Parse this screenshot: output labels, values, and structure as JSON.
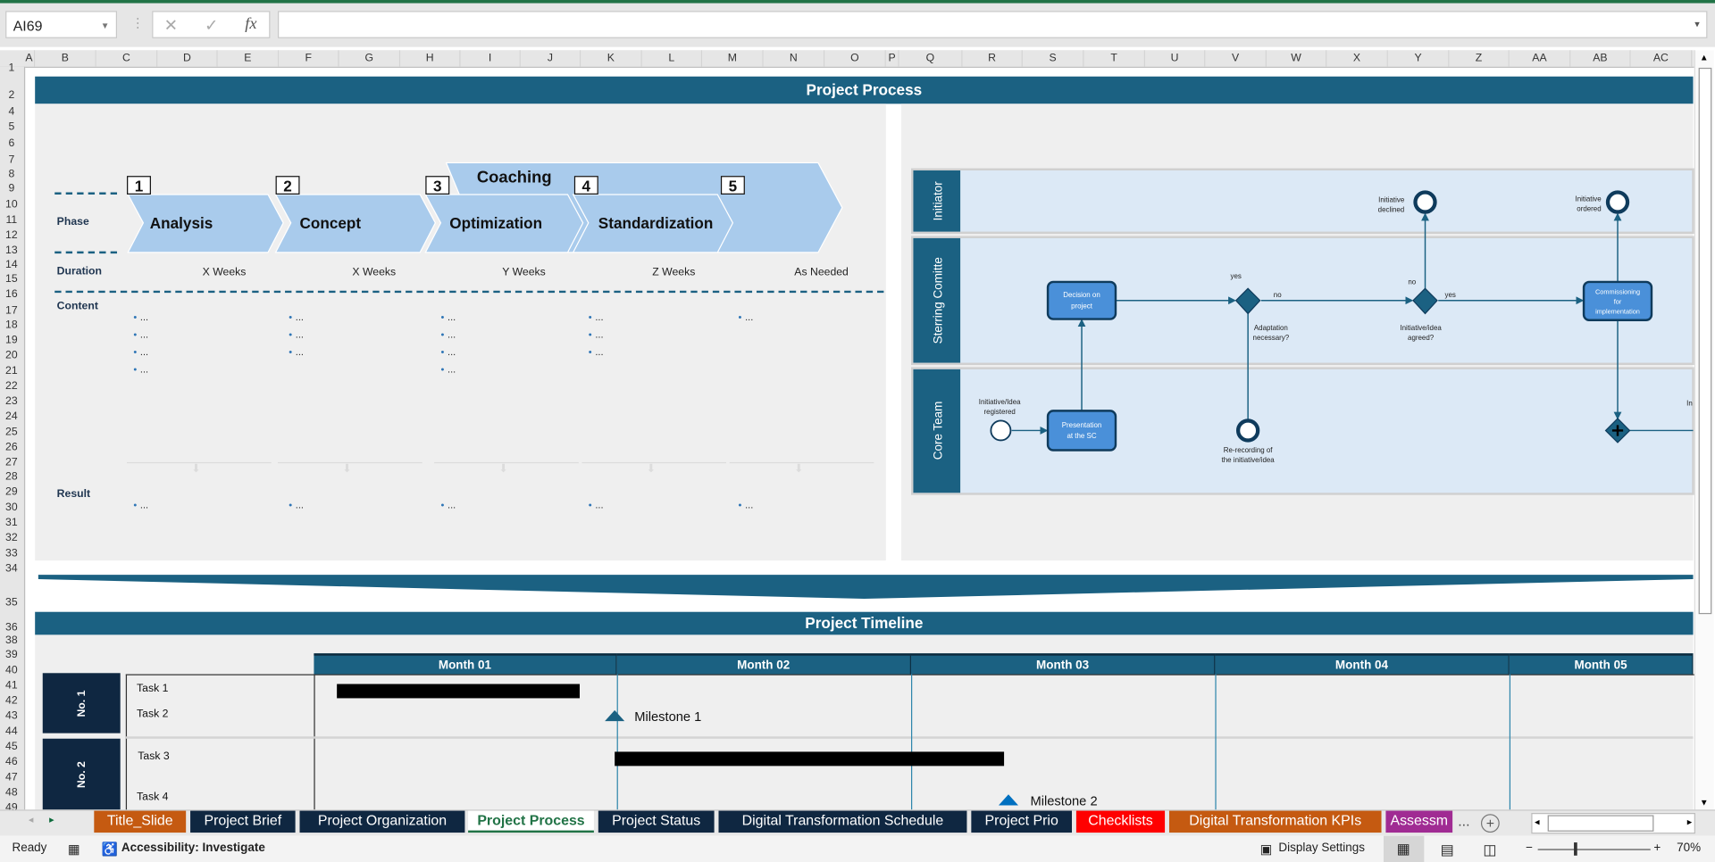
{
  "formula_bar": {
    "name_box": "AI69",
    "cancel_icon": "✕",
    "enter_icon": "✓",
    "fx_label": "fx",
    "formula": ""
  },
  "columns": [
    "A",
    "B",
    "C",
    "D",
    "E",
    "F",
    "G",
    "H",
    "I",
    "J",
    "K",
    "L",
    "M",
    "N",
    "O",
    "P",
    "Q",
    "R",
    "S",
    "T",
    "U",
    "V",
    "W",
    "X",
    "Y",
    "Z",
    "AA",
    "AB",
    "AC"
  ],
  "rows": [
    "1",
    "2",
    "4",
    "5",
    "6",
    "7",
    "8",
    "9",
    "10",
    "11",
    "12",
    "13",
    "14",
    "15",
    "16",
    "17",
    "18",
    "19",
    "20",
    "21",
    "22",
    "23",
    "24",
    "25",
    "26",
    "27",
    "28",
    "29",
    "30",
    "31",
    "32",
    "33",
    "34",
    "35",
    "36",
    "38",
    "39",
    "40",
    "41",
    "42",
    "43",
    "44",
    "45",
    "46",
    "47",
    "48",
    "49"
  ],
  "process": {
    "title": "Project Process",
    "labels": {
      "phase": "Phase",
      "duration": "Duration",
      "content": "Content",
      "result": "Result"
    },
    "coaching": "Coaching",
    "phases": [
      {
        "num": "1",
        "name": "Analysis",
        "duration": "X Weeks",
        "content": [
          "...",
          "...",
          "...",
          "..."
        ],
        "result": [
          "..."
        ]
      },
      {
        "num": "2",
        "name": "Concept",
        "duration": "X Weeks",
        "content": [
          "...",
          "...",
          "..."
        ],
        "result": [
          "..."
        ]
      },
      {
        "num": "3",
        "name": "Optimization",
        "duration": "Y Weeks",
        "content": [
          "...",
          "...",
          "...",
          "..."
        ],
        "result": [
          "..."
        ]
      },
      {
        "num": "4",
        "name": "Standardization",
        "duration": "Z Weeks",
        "content": [
          "...",
          "...",
          "..."
        ],
        "result": [
          "..."
        ]
      },
      {
        "num": "5",
        "name": "",
        "duration": "As Needed",
        "content": [
          "..."
        ],
        "result": [
          "..."
        ]
      }
    ],
    "colors": {
      "chevron": "#a9cbec",
      "band": "#1b6182"
    }
  },
  "swimlane": {
    "lanes": [
      "Initiator",
      "Sterring Comitte",
      "Core Team"
    ],
    "decision_box": [
      "Decision on",
      "project"
    ],
    "presentation_box": [
      "Presentation",
      "at the SC"
    ],
    "commissioning_box": [
      "Commissioning",
      "for",
      "implementation"
    ],
    "start_label": [
      "Initiative/Idea",
      "registered"
    ],
    "declined_label": [
      "Initiative",
      "declined"
    ],
    "ordered_label": [
      "Initiative",
      "ordered"
    ],
    "adaptation_label": [
      "Adaptation",
      "necessary?"
    ],
    "agreed_label": [
      "Initiative/idea",
      "agreed?"
    ],
    "rerecording_label": [
      "Re-recording of",
      "the initiative/idea"
    ],
    "yes": "yes",
    "no": "no",
    "clipped_label": "In"
  },
  "timeline": {
    "title": "Project Timeline",
    "months": [
      "Month 01",
      "Month 02",
      "Month 03",
      "Month 04",
      "Month 05"
    ],
    "groups": [
      {
        "label": "No. 1",
        "tasks": [
          "Task 1",
          "Task 2"
        ]
      },
      {
        "label": "No. 2",
        "tasks": [
          "Task 3",
          "Task 4"
        ]
      }
    ],
    "milestones": [
      "Milestone 1",
      "Milestone 2"
    ]
  },
  "tabs": [
    {
      "label": "Title_Slide",
      "color": "#c55a11"
    },
    {
      "label": "Project Brief",
      "color": "#0f2741"
    },
    {
      "label": "Project Organization",
      "color": "#0f2741"
    },
    {
      "label": "Project Process",
      "color": "#ffffff",
      "active": true
    },
    {
      "label": "Project Status",
      "color": "#0f2741"
    },
    {
      "label": "Digital Transformation Schedule",
      "color": "#0f2741"
    },
    {
      "label": "Project Prio",
      "color": "#0f2741"
    },
    {
      "label": "Checklists",
      "color": "#ff0000"
    },
    {
      "label": "Digital Transformation KPIs",
      "color": "#c55a11"
    },
    {
      "label": "Assessm",
      "color": "#a02b93"
    }
  ],
  "tabs_more": "...",
  "status": {
    "ready": "Ready",
    "accessibility": "Accessibility: Investigate",
    "display_settings": "Display Settings",
    "zoom": "70%"
  }
}
